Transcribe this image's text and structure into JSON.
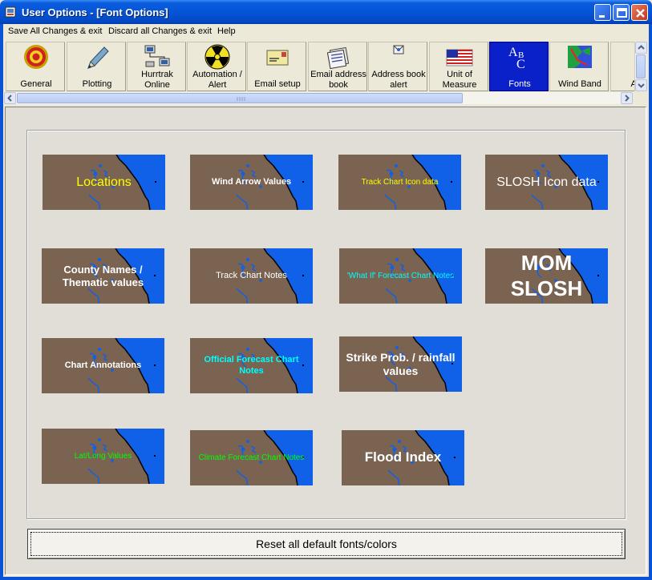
{
  "window": {
    "title": "User Options - [Font Options]"
  },
  "menu": {
    "items": [
      "Save All Changes & exit",
      "Discard all Changes & exit",
      "Help"
    ]
  },
  "toolbar": {
    "items": [
      {
        "label": "General",
        "icon": "target-icon"
      },
      {
        "label": "Plotting",
        "icon": "pencil-icon"
      },
      {
        "label": "Hurrtrak\nOnline",
        "icon": "network-icon"
      },
      {
        "label": "Automation /\nAlert",
        "icon": "radiation-icon"
      },
      {
        "label": "Email setup",
        "icon": "envelope-icon"
      },
      {
        "label": "Email address\nbook",
        "icon": "address-book-icon"
      },
      {
        "label": "Address book\nalert",
        "icon": "address-alert-icon"
      },
      {
        "label": "Unit of\nMeasure",
        "icon": "us-flag-icon"
      },
      {
        "label": "Fonts",
        "icon": "fonts-abc-icon",
        "selected": true
      },
      {
        "label": "Wind Band",
        "icon": "wind-band-map-icon"
      },
      {
        "label": "Anim",
        "icon": "animation-icon"
      }
    ]
  },
  "font_tiles": [
    {
      "label": "Locations",
      "color": "#ffff00",
      "size": 16,
      "bold": false
    },
    {
      "label": "Wind Arrow Values",
      "color": "#ffffff",
      "size": 11,
      "bold": true
    },
    {
      "label": "Track Chart Icon data",
      "color": "#ffff00",
      "size": 10,
      "bold": false
    },
    {
      "label": "SLOSH Icon data",
      "color": "#ffffff",
      "size": 16,
      "bold": false
    },
    {
      "label": "County Names /\nThematic values",
      "color": "#ffffff",
      "size": 13,
      "bold": true
    },
    {
      "label": "Track Chart Notes",
      "color": "#ffffff",
      "size": 11,
      "bold": false
    },
    {
      "label": "'What If' Forecast Chart Notes",
      "color": "#00ffff",
      "size": 10,
      "bold": false
    },
    {
      "label": "MOM\nSLOSH",
      "color": "#ffffff",
      "size": 26,
      "bold": true
    },
    {
      "label": "Chart Annotations",
      "color": "#ffffff",
      "size": 11,
      "bold": true
    },
    {
      "label": "Official Forecast Chart\nNotes",
      "color": "#00ffff",
      "size": 11,
      "bold": true
    },
    {
      "label": "Strike Prob. / rainfall\nvalues",
      "color": "#ffffff",
      "size": 14,
      "bold": true
    },
    {
      "label": "Lat/Long Values",
      "color": "#00ff00",
      "size": 10,
      "bold": false
    },
    {
      "label": "Climate Forecast Chart Notes",
      "color": "#00ff00",
      "size": 10,
      "bold": false
    },
    {
      "label": "Flood Index",
      "color": "#ffffff",
      "size": 17,
      "bold": true
    }
  ],
  "reset_button": {
    "label": "Reset all default fonts/colors"
  },
  "colors": {
    "land": "#7a6350",
    "water": "#1060e8"
  }
}
